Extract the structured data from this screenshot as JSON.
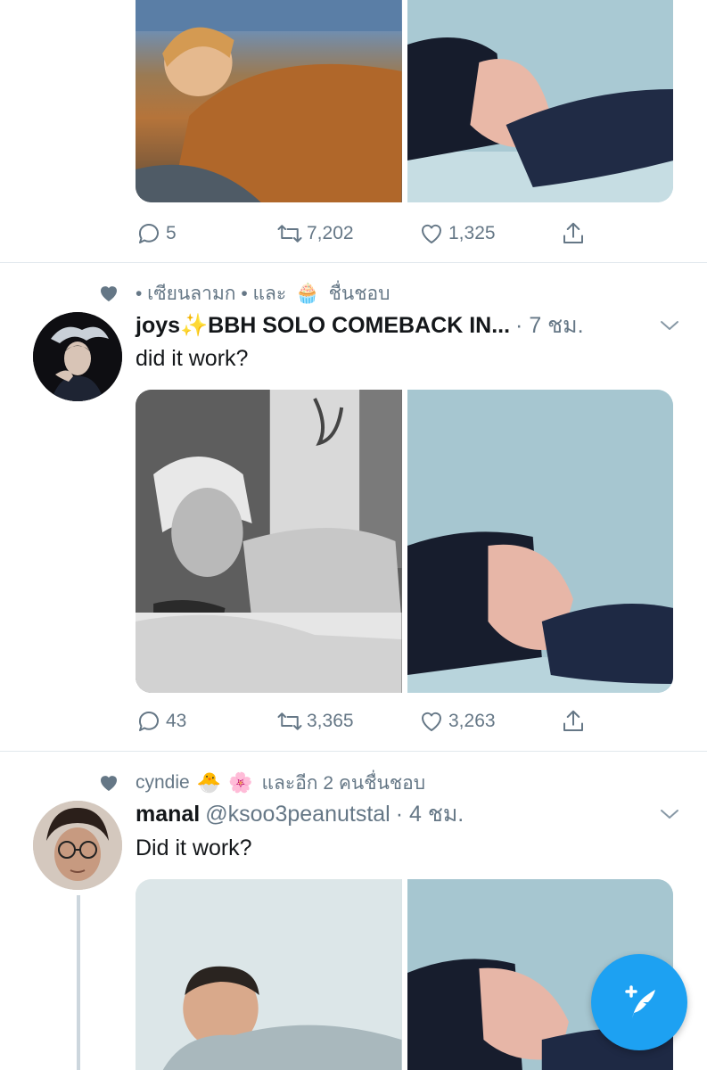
{
  "tweet1": {
    "replies": "5",
    "retweets": "7,202",
    "likes": "1,325"
  },
  "tweet2": {
    "social": {
      "text_before": "• เซียนลามก • และ",
      "emoji": "🧁",
      "text_after": "ชื่นชอบ"
    },
    "name": "joys✨BBH SOLO COMEBACK IN...",
    "time": "· 7 ชม.",
    "text": "did it work?",
    "replies": "43",
    "retweets": "3,365",
    "likes": "3,263"
  },
  "tweet3": {
    "social": {
      "name": "cyndie",
      "emoji1": "🐣",
      "emoji2": "🌸",
      "text_after": "และอีก 2 คนชื่นชอบ"
    },
    "name": "manal",
    "handle": "@ksoo3peanutstal",
    "time": "· 4 ชม.",
    "text": "Did it work?"
  },
  "icons": {
    "reply": "reply-icon",
    "retweet": "retweet-icon",
    "like": "heart-icon",
    "share": "share-icon",
    "compose": "compose-tweet-icon"
  },
  "colors": {
    "accent": "#1da1f2",
    "secondary_text": "#657786",
    "divider": "#e1e8ed"
  }
}
